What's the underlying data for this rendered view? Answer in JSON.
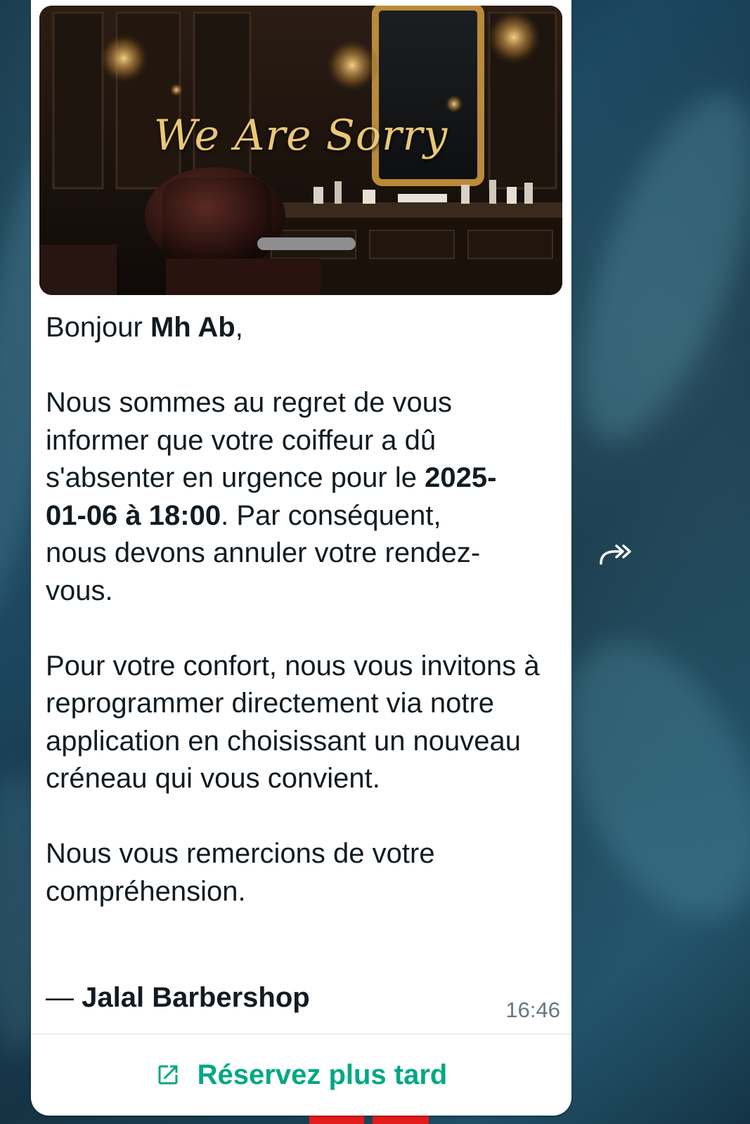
{
  "message": {
    "greeting_prefix": "Bonjour ",
    "customer_name": "Mh Ab",
    "greeting_suffix": ",",
    "p1_before": "Nous sommes au regret de vous informer que votre coiffeur a dû s'absenter en urgence pour le ",
    "appointment_datetime": "2025-01-06 à 18:00",
    "p1_after": ". Par conséquent, nous devons annuler votre rendez-vous.",
    "p2": "Pour votre confort, nous vous invitons à reprogrammer directement via notre application en choisissant un nouveau créneau qui vous convient.",
    "p3": "Nous vous remercions de votre compréhension.",
    "signature_dash": "— ",
    "signature": "Jalal Barbershop",
    "time": "16:46"
  },
  "hero": {
    "title": "We Are Sorry"
  },
  "cta": {
    "label": "Réservez plus tard",
    "icon": "external-link-icon"
  },
  "forward": {
    "icon": "forward-icon"
  },
  "colors": {
    "accent": "#00a884",
    "bubble": "#ffffff",
    "text": "#111b21",
    "meta": "#667781",
    "hero_title": "#e9c774"
  }
}
